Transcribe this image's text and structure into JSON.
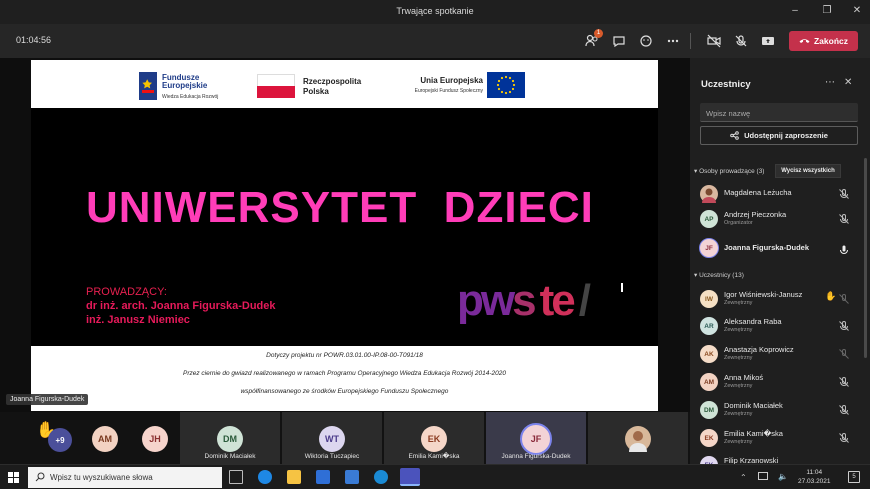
{
  "window": {
    "title": "Trwające spotkanie"
  },
  "meeting": {
    "timer": "01:04:56",
    "participants_badge": "1",
    "end_label": "Zakończ"
  },
  "slide": {
    "logo_fe": {
      "line1": "Fundusze",
      "line2": "Europejskie",
      "line3": "Wiedza Edukacja Rozwój"
    },
    "logo_rp": {
      "line1": "Rzeczpospolita",
      "line2": "Polska"
    },
    "logo_ue": {
      "line1": "Unia Europejska",
      "line2": "Europejski Fundusz Społeczny"
    },
    "title": "UNIWERSYTET  DZIECI",
    "presenters_label": "PROWADZĄCY:",
    "presenter1": "dr inż. arch. Joanna Figurska-Dudek",
    "presenter2": "inż. Janusz Niemiec",
    "brand": {
      "p1": "pw",
      "p2": "s",
      "p3": "te",
      "p4": "/"
    },
    "footer1": "Dotyczy projektu nr POWR.03.01.00-IP.08-00-T091/18",
    "footer2": "Przez ciernie do gwiazd realizowanego w ramach Programu Operacyjnego Wiedza Edukacja Rozwój 2014-2020",
    "footer3": "współfinansowanego ze środków Europejskiego Funduszu Społecznego"
  },
  "stage_name_tag": "Joanna Figurska-Dudek",
  "strip": {
    "more_count": "+9",
    "tiles": [
      {
        "initials": "AM",
        "name": ""
      },
      {
        "initials": "JH",
        "name": ""
      },
      {
        "initials": "DM",
        "name": "Dominik Maciałek"
      },
      {
        "initials": "WT",
        "name": "Wiktoria Tuczapiec"
      },
      {
        "initials": "EK",
        "name": "Emilia Kami�ska"
      },
      {
        "initials": "JF",
        "name": "Joanna Figurska-Dudek"
      }
    ]
  },
  "panel": {
    "title": "Uczestnicy",
    "search_placeholder": "Wpisz nazwę",
    "share_label": "Udostępnij zaproszenie",
    "presenters_header": "Osoby prowadzące (3)",
    "mute_all": "Wycisz wszystkich",
    "attendees_header": "Uczestnicy (13)",
    "presenters": [
      {
        "initials": "ML",
        "name": "Magdalena Leżucha",
        "role": ""
      },
      {
        "initials": "AP",
        "name": "Andrzej Pieczonka",
        "role": "Organizator"
      },
      {
        "initials": "JF",
        "name": "Joanna Figurska-Dudek",
        "role": ""
      }
    ],
    "attendees": [
      {
        "initials": "IW",
        "name": "Igor Wiśniewski-Janusz",
        "role": "Zewnętrzny"
      },
      {
        "initials": "AR",
        "name": "Aleksandra Raba",
        "role": "Zewnętrzny"
      },
      {
        "initials": "AK",
        "name": "Anastazja Koprowicz",
        "role": "Zewnętrzny"
      },
      {
        "initials": "AM",
        "name": "Anna Mikoś",
        "role": "Zewnętrzny"
      },
      {
        "initials": "DM",
        "name": "Dominik Maciałek",
        "role": "Zewnętrzny"
      },
      {
        "initials": "EK",
        "name": "Emilia Kami�ska",
        "role": "Zewnętrzny"
      },
      {
        "initials": "FK",
        "name": "Filip Krzanowski",
        "role": ""
      }
    ]
  },
  "taskbar": {
    "search_placeholder": "Wpisz tu wyszukiwane słowa",
    "time": "11:04",
    "date": "27.03.2021",
    "notif_count": "5"
  }
}
